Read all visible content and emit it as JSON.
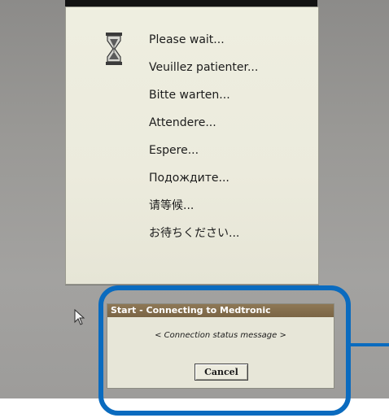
{
  "wait_window": {
    "icon": "hourglass-icon",
    "messages": [
      "Please wait...",
      "Veuillez patienter...",
      "Bitte warten...",
      "Attendere...",
      "Espere...",
      "Подождите...",
      "请等候...",
      "お待ちください..."
    ]
  },
  "dialog": {
    "title": "Start - Connecting to Medtronic",
    "status_message": "< Connection status message >",
    "cancel_label": "Cancel"
  },
  "colors": {
    "screen_background": "#9a9996",
    "panel_background": "#eeeee0",
    "dialog_title_bar": "#8e7856",
    "highlight_border": "#0a6bbf"
  }
}
